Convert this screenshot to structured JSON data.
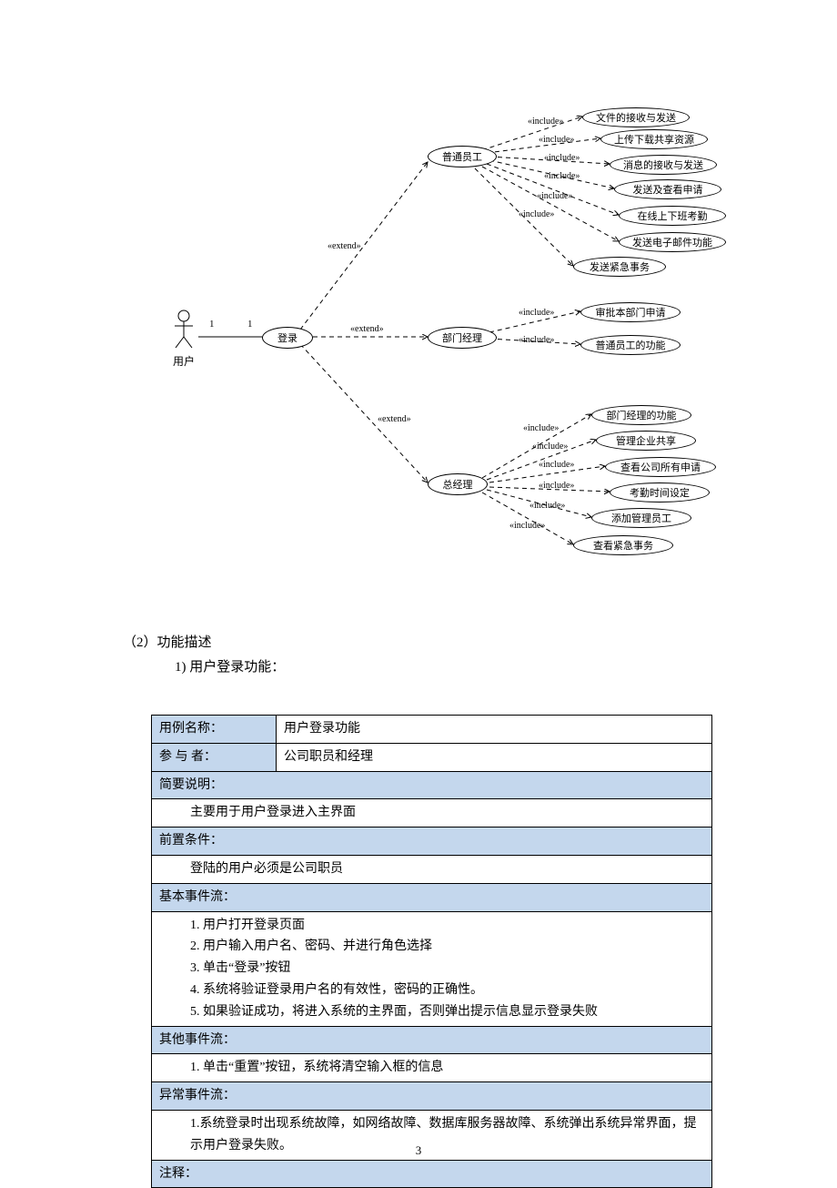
{
  "uml": {
    "actor": "用户",
    "mult1": "1",
    "mult2": "1",
    "login": "登录",
    "extend": "«extend»",
    "include": "«include»",
    "roles": {
      "staff": "普通员工",
      "dept": "部门经理",
      "gm": "总经理"
    },
    "staff_uc": [
      "文件的接收与发送",
      "上传下载共享资源",
      "消息的接收与发送",
      "发送及查看申请",
      "在线上下班考勤",
      "发送电子邮件功能",
      "发送紧急事务"
    ],
    "dept_uc": [
      "审批本部门申请",
      "普通员工的功能"
    ],
    "gm_uc": [
      "部门经理的功能",
      "管理企业共享",
      "查看公司所有申请",
      "考勤时间设定",
      "添加管理员工",
      "查看紧急事务"
    ]
  },
  "text": {
    "s2": "（2）功能描述",
    "s2_1": "1)  用户登录功能："
  },
  "table": {
    "r1l": "用例名称：",
    "r1v": "用户登录功能",
    "r2l": "参 与 者：",
    "r2v": "公司职员和经理",
    "r3l": "简要说明：",
    "r3v": "主要用于用户登录进入主界面",
    "r4l": "前置条件：",
    "r4v": "登陆的用户必须是公司职员",
    "r5l": "基本事件流：",
    "r5v": "1.  用户打开登录页面\n2.  用户输入用户名、密码、并进行角色选择\n3.  单击“登录”按钮\n4.  系统将验证登录用户名的有效性，密码的正确性。\n5.  如果验证成功，将进入系统的主界面，否则弹出提示信息显示登录失败",
    "r6l": "其他事件流：",
    "r6v": "1.  单击“重置”按钮，系统将清空输入框的信息",
    "r7l": "异常事件流：",
    "r7v": "1.系统登录时出现系统故障，如网络故障、数据库服务器故障、系统弹出系统异常界面，提示用户登录失败。",
    "r8l": "注释："
  },
  "pagenum": "3"
}
